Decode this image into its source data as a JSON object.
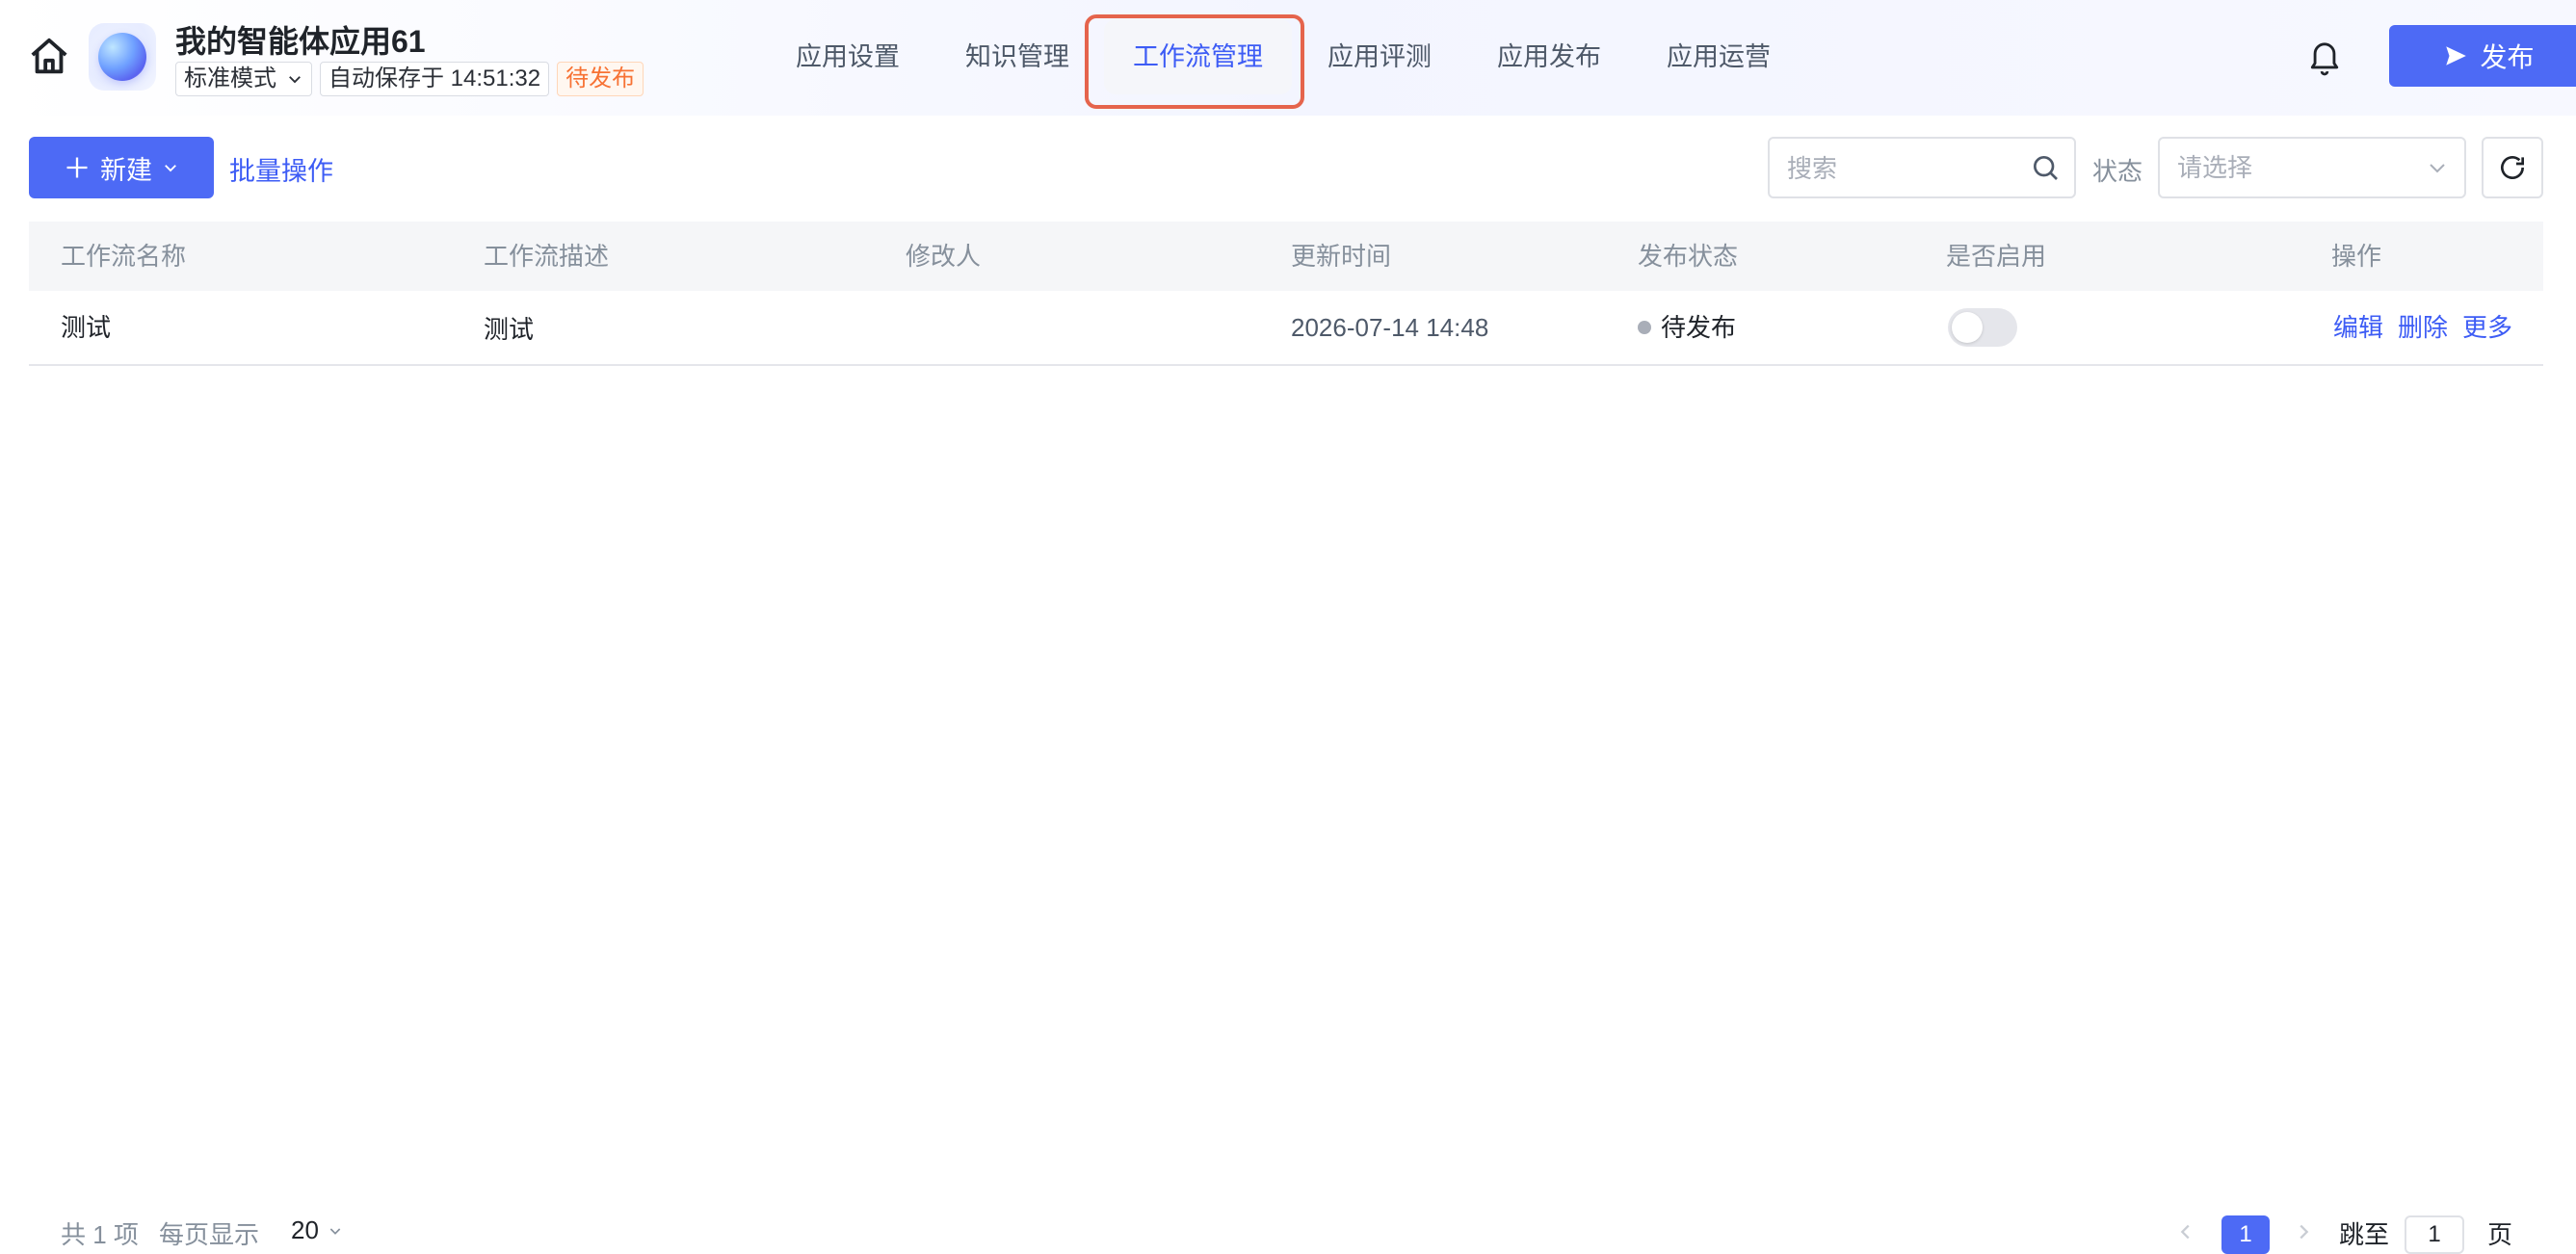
{
  "header": {
    "app_title": "我的智能体应用61",
    "mode_label": "标准模式",
    "autosave_text": "自动保存于 14:51:32",
    "status_badge": "待发布",
    "publish_label": "发布",
    "icons": [
      "home-icon",
      "app-logo",
      "chevron-down-icon",
      "bell-icon",
      "send-icon"
    ]
  },
  "nav": {
    "tabs": [
      {
        "label": "应用设置",
        "active": false
      },
      {
        "label": "知识管理",
        "active": false
      },
      {
        "label": "工作流管理",
        "active": true
      },
      {
        "label": "应用评测",
        "active": false
      },
      {
        "label": "应用发布",
        "active": false
      },
      {
        "label": "应用运营",
        "active": false
      }
    ]
  },
  "toolbar": {
    "new_label": "新建",
    "batch_label": "批量操作",
    "search_placeholder": "搜索",
    "status_label": "状态",
    "status_placeholder": "请选择"
  },
  "table": {
    "columns": [
      "工作流名称",
      "工作流描述",
      "修改人",
      "更新时间",
      "发布状态",
      "是否启用",
      "操作"
    ],
    "rows": [
      {
        "name": "测试",
        "description": "测试",
        "modifier": "",
        "updated_at": "2026-07-14 14:48",
        "publish_status": "待发布",
        "enabled": false,
        "actions": [
          "编辑",
          "删除",
          "更多"
        ]
      }
    ]
  },
  "footer": {
    "total_text": "共 1 项",
    "per_page_label": "每页显示",
    "per_page_value": "20",
    "current_page": "1",
    "jump_label": "跳至",
    "jump_value": "1",
    "page_suffix": "页"
  },
  "colors": {
    "accent": "#4d6af5",
    "highlight_border": "#e5644c",
    "pending_orange": "#f77234"
  }
}
